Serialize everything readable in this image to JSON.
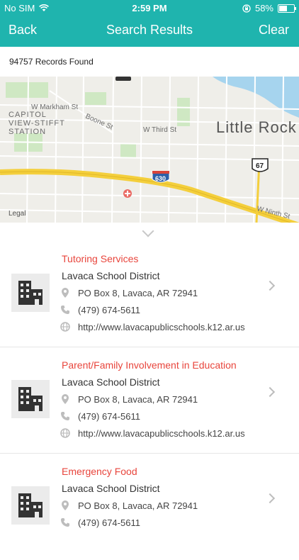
{
  "status": {
    "carrier": "No SIM",
    "time": "2:59 PM",
    "battery": "58%",
    "battery_level": 0.58
  },
  "nav": {
    "back": "Back",
    "title": "Search Results",
    "clear": "Clear"
  },
  "records_found": "94757 Records Found",
  "map": {
    "labels": {
      "markham": "W Markham St",
      "boone": "Boone St",
      "third": "W Third St",
      "capitol": "CAPITOL",
      "view_stifft": "VIEW-STIFFT",
      "station": "STATION",
      "little_rock": "Little Rock",
      "route_630": "630",
      "route_67": "67",
      "ninth": "W Ninth St",
      "legal": "Legal"
    }
  },
  "results": [
    {
      "category": "Tutoring Services",
      "organization": "Lavaca School District",
      "address": "PO Box 8, Lavaca, AR 72941",
      "phone": "(479) 674-5611",
      "website": "http://www.lavacapublicschools.k12.ar.us"
    },
    {
      "category": "Parent/Family Involvement in Education",
      "organization": "Lavaca School District",
      "address": "PO Box 8, Lavaca, AR 72941",
      "phone": "(479) 674-5611",
      "website": "http://www.lavacapublicschools.k12.ar.us"
    },
    {
      "category": "Emergency Food",
      "organization": "Lavaca School District",
      "address": "PO Box 8, Lavaca, AR 72941",
      "phone": "(479) 674-5611",
      "website": ""
    }
  ],
  "colors": {
    "teal": "#1fb4ae",
    "category_red": "#e8453c",
    "highway_yellow": "#f4cf3c",
    "water_blue": "#a6d4ee"
  }
}
